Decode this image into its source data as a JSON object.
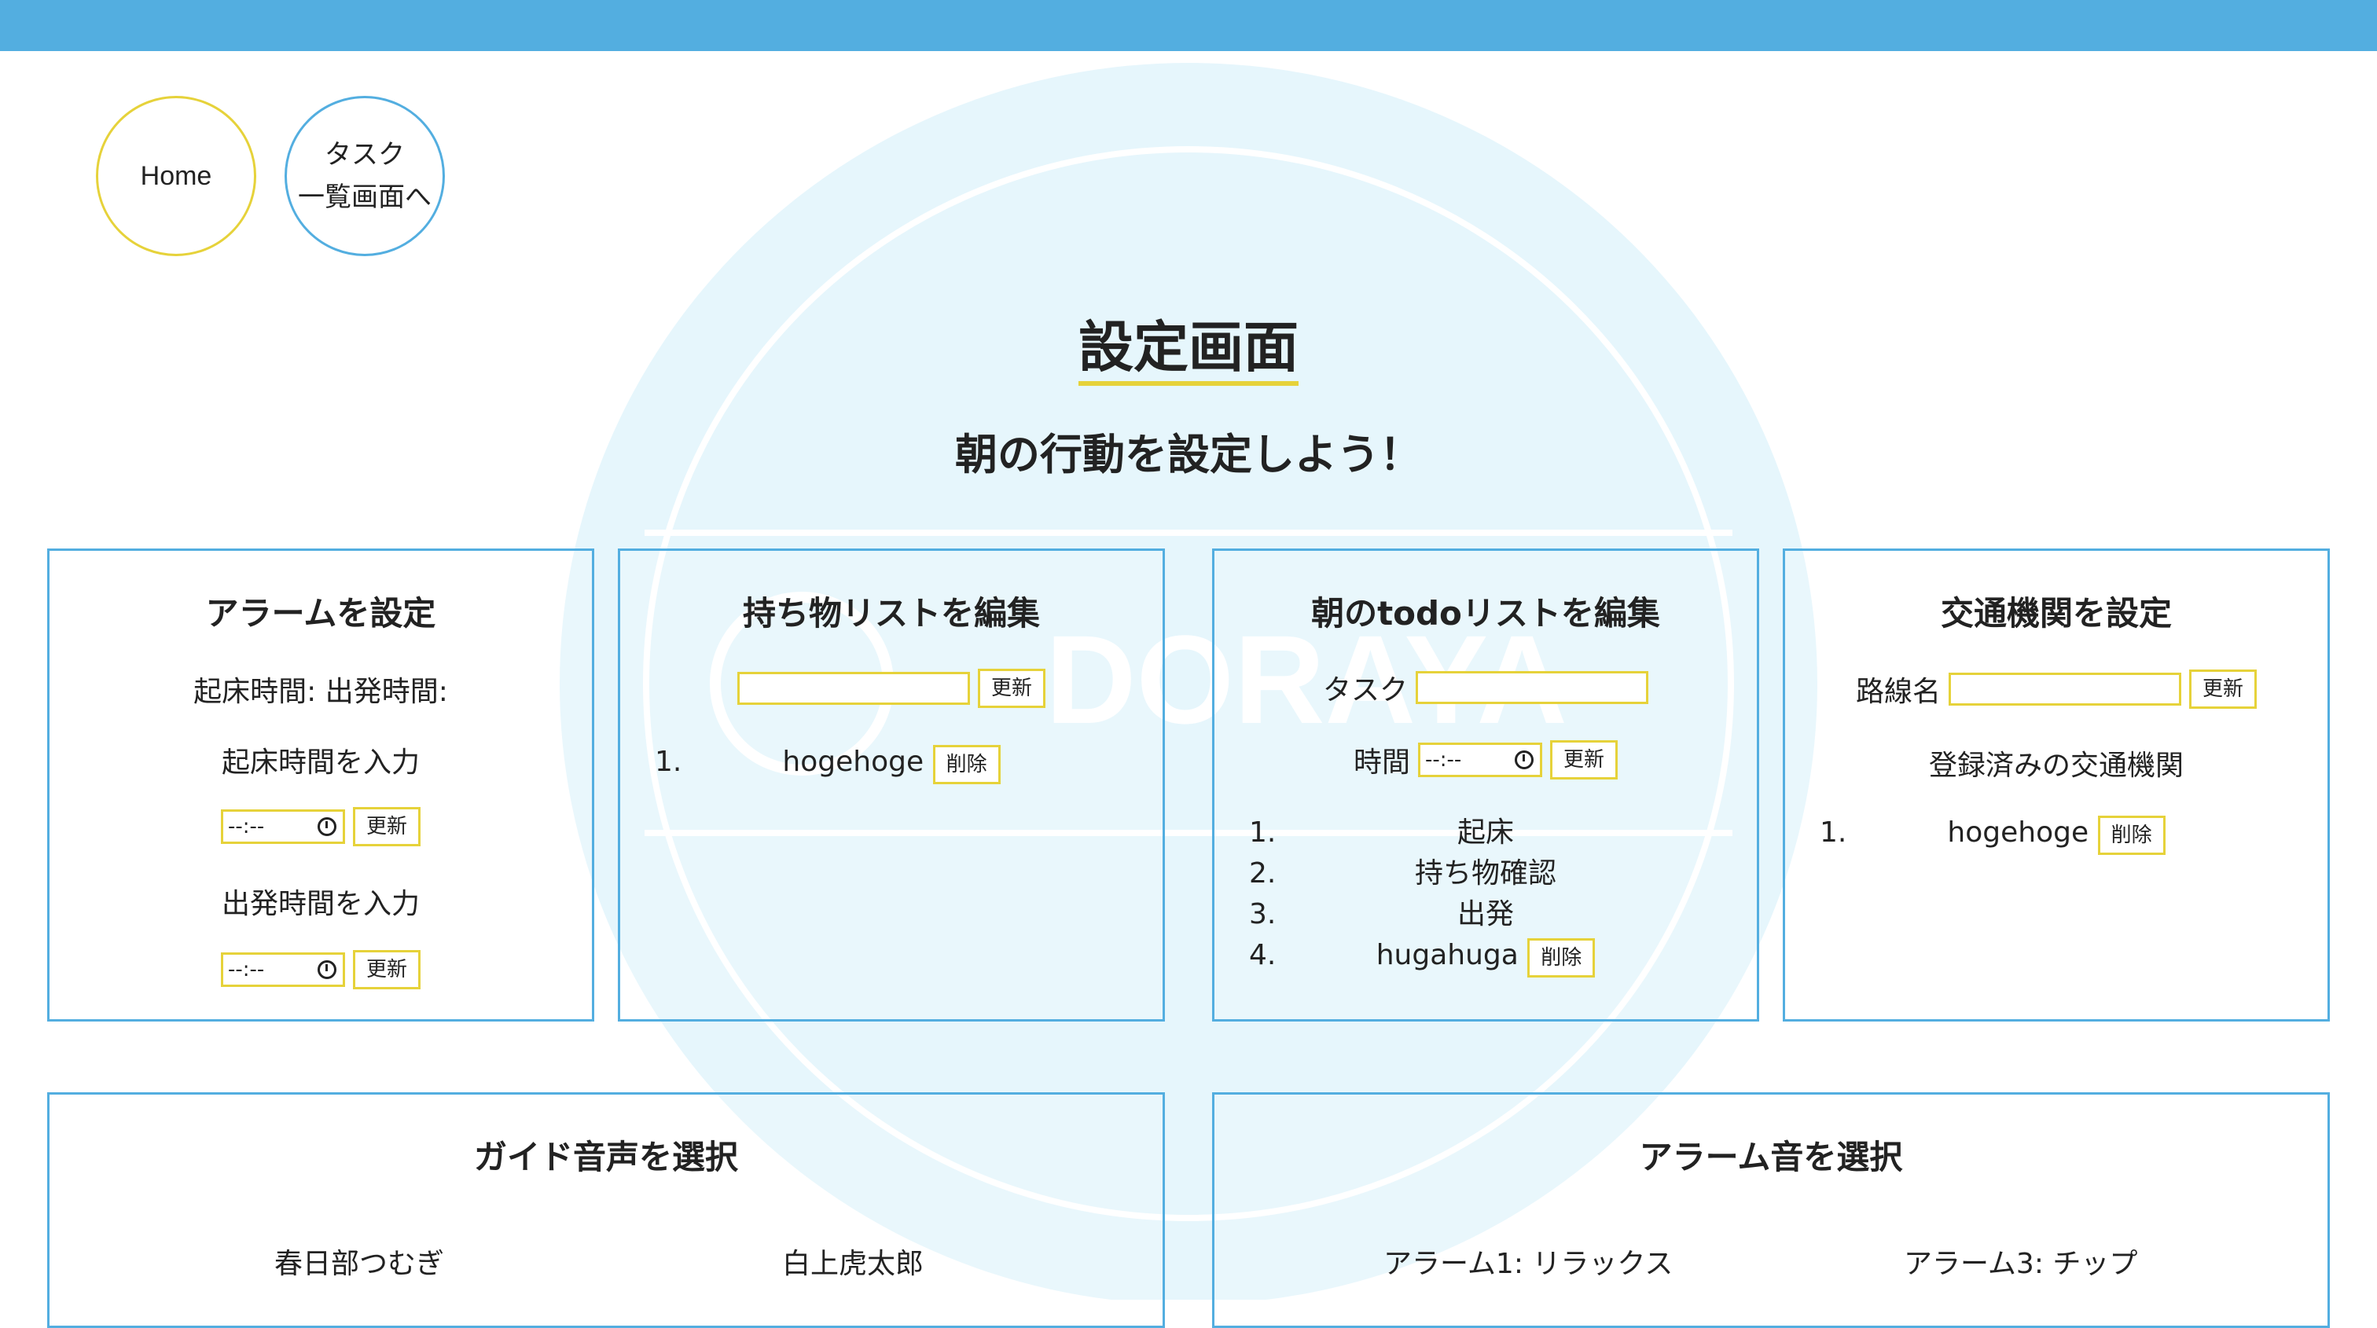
{
  "nav": {
    "home": "Home",
    "task_line1": "タスク",
    "task_line2": "一覧画面へ"
  },
  "title": "設定画面",
  "subtitle": "朝の行動を設定しよう！",
  "watermark": "DORAYA",
  "alarm": {
    "heading": "アラームを設定",
    "status": "起床時間: 出発時間:",
    "wake_label": "起床時間を入力",
    "leave_label": "出発時間を入力",
    "time_placeholder": "--:--",
    "update": "更新"
  },
  "belongings": {
    "heading": "持ち物リストを編集",
    "update": "更新",
    "delete": "削除",
    "items": [
      {
        "num": "1.",
        "label": "hogehoge"
      }
    ]
  },
  "todo": {
    "heading": "朝のtodoリストを編集",
    "task_label": "タスク",
    "time_label": "時間",
    "time_placeholder": "--:--",
    "update": "更新",
    "delete": "削除",
    "items": [
      {
        "num": "1.",
        "label": "起床"
      },
      {
        "num": "2.",
        "label": "持ち物確認"
      },
      {
        "num": "3.",
        "label": "出発"
      },
      {
        "num": "4.",
        "label": "hugahuga"
      }
    ]
  },
  "transport": {
    "heading": "交通機関を設定",
    "route_label": "路線名",
    "update": "更新",
    "registered_label": "登録済みの交通機関",
    "delete": "削除",
    "items": [
      {
        "num": "1.",
        "label": "hogehoge"
      }
    ]
  },
  "guide_voice": {
    "heading": "ガイド音声を選択",
    "options": [
      "春日部つむぎ",
      "白上虎太郎"
    ]
  },
  "alarm_sound": {
    "heading": "アラーム音を選択",
    "options": [
      "アラーム1: リラックス",
      "アラーム3: チップ"
    ]
  },
  "colors": {
    "accent_blue": "#53aee0",
    "accent_yellow": "#e6d23a"
  }
}
